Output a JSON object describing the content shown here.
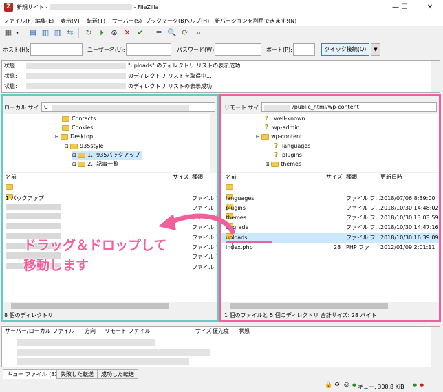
{
  "window": {
    "title_prefix": "新規サイト - ",
    "title_suffix": " - FileZilla",
    "minimize": "—",
    "maximize": "☐",
    "close": "✕"
  },
  "menu": [
    "ファイル(F)",
    "編集(E)",
    "表示(V)",
    "転送(T)",
    "サーバー(S)",
    "ブックマーク(B)",
    "ヘルプ(H)",
    "新バージョンを利用できます!(N)"
  ],
  "toolbar_icons": [
    "site-manager-icon",
    "dropdown-arrow-icon",
    "message-log-icon",
    "local-tree-icon",
    "remote-tree-icon",
    "transfer-queue-icon",
    "refresh-icon",
    "process-queue-icon",
    "cancel-icon",
    "disconnect-icon",
    "reconnect-icon",
    "directory-listing-filter-icon",
    "toggle-comparison-icon",
    "synchronized-browsing-icon",
    "search-icon"
  ],
  "quickconnect": {
    "host_label": "ホスト(H):",
    "user_label": "ユーザー名(U):",
    "pass_label": "パスワード(W):",
    "port_label": "ポート(P):",
    "button": "クイック接続(Q)",
    "dropdown": "▼"
  },
  "log": [
    {
      "prefix": "状態:",
      "text": "\"uploads\" のディレクトリ リストの表示成功"
    },
    {
      "prefix": "状態:",
      "text": "のディレクトリ リストを取得中..."
    },
    {
      "prefix": "状態:",
      "text": "のディレクトリ リストの表示成功"
    }
  ],
  "local": {
    "site_label": "ローカル サイト:",
    "site_value": "C",
    "tree": [
      {
        "label": "Contacts",
        "icon": "folder"
      },
      {
        "label": "Cookies",
        "icon": "folder"
      },
      {
        "label": "Desktop",
        "icon": "folder"
      },
      {
        "label": "935style",
        "icon": "folder"
      },
      {
        "label": "1、935バックアップ",
        "icon": "folder"
      },
      {
        "label": "2、記事一覧",
        "icon": "folder"
      }
    ],
    "headers": {
      "name": "名前",
      "size": "サイズ",
      "type": "種類"
    },
    "files": [
      {
        "name": "..",
        "size": "",
        "type": ""
      },
      {
        "name": "1.バックアップ",
        "size": "",
        "type": "ファイル フ..."
      },
      {
        "name": "",
        "size": "",
        "type": "ファイル フ..."
      },
      {
        "name": "",
        "size": "",
        "type": "ファイル フ..."
      },
      {
        "name": "",
        "size": "",
        "type": "ファイル フ..."
      },
      {
        "name": "",
        "size": "",
        "type": "ファイル フ..."
      },
      {
        "name": "",
        "size": "",
        "type": "ファイル フ..."
      },
      {
        "name": "",
        "size": "",
        "type": "ファイル フ..."
      },
      {
        "name": "",
        "size": "",
        "type": "ファイル フ..."
      }
    ],
    "status": "8 個のディレクトリ"
  },
  "remote": {
    "site_label": "リモート サイト:",
    "site_value": "/public_html/wp-content",
    "tree": [
      {
        "label": ".well-known",
        "icon": "question"
      },
      {
        "label": "wp-admin",
        "icon": "question"
      },
      {
        "label": "wp-content",
        "icon": "folder"
      },
      {
        "label": "languages",
        "icon": "question"
      },
      {
        "label": "plugins",
        "icon": "question"
      },
      {
        "label": "themes",
        "icon": "folder"
      }
    ],
    "headers": {
      "name": "名前",
      "size": "サイズ",
      "type": "種類",
      "modified": "更新日時"
    },
    "files": [
      {
        "name": "..",
        "size": "",
        "type": "",
        "modified": ""
      },
      {
        "name": "languages",
        "size": "",
        "type": "ファイル フ...",
        "modified": "2018/07/06 8:39:00"
      },
      {
        "name": "plugins",
        "size": "",
        "type": "ファイル フ...",
        "modified": "2018/10/30 14:48:02"
      },
      {
        "name": "themes",
        "size": "",
        "type": "ファイル フ...",
        "modified": "2018/10/30 13:03:59"
      },
      {
        "name": "upgrade",
        "size": "",
        "type": "ファイル フ...",
        "modified": "2018/10/30 14:47:16"
      },
      {
        "name": "uploads",
        "size": "",
        "type": "ファイル フ...",
        "modified": "2018/10/30 16:39:09"
      },
      {
        "name": "index.php",
        "size": "28",
        "type": "PHP ファ",
        "modified": "2012/01/09 2:01:11"
      }
    ],
    "status": "1 個のファイルと 5 個のディレクトリ 合計サイズ: 28 バイト"
  },
  "annotation": {
    "line1": "ドラッグ＆ドロップして",
    "line2": "移動します",
    "color": "#f0609b"
  },
  "queue": {
    "headers": {
      "file": "サーバー/ローカル ファイル",
      "direction": "方向",
      "remote": "リモート ファイル",
      "size": "サイズ",
      "priority": "優先度",
      "state": "状態"
    },
    "tabs": [
      "キュー ファイル (33)",
      "失敗した転送",
      "成功した転送"
    ]
  },
  "statusbar": {
    "queue": "キュー: 308.8 KiB"
  }
}
